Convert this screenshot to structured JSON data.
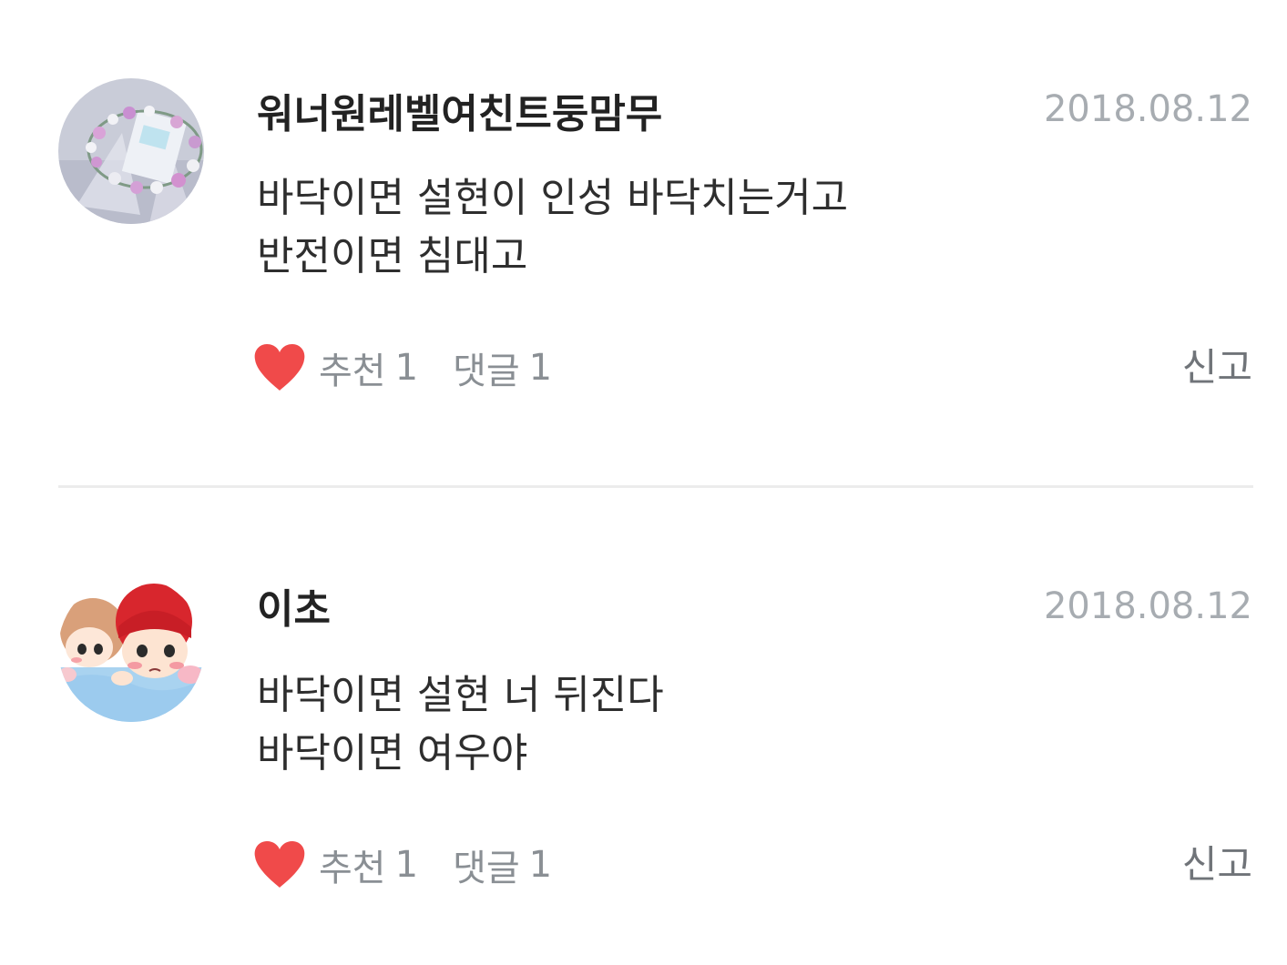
{
  "comments": [
    {
      "username": "워너원레벨여친트둥맘무",
      "date": "2018.08.12",
      "body_lines": [
        "바닥이면 설현이 인성 바닥치는거고",
        "반전이면 침대고"
      ],
      "like_label": "추천",
      "like_count": "1",
      "comment_label": "댓글",
      "comment_count": "1",
      "report_label": "신고",
      "avatar_icon": "flower-crown-photo-avatar"
    },
    {
      "username": "이초",
      "date": "2018.08.12",
      "body_lines": [
        "바닥이면 설현 너 뒤진다",
        "바닥이면 여우야"
      ],
      "like_label": "추천",
      "like_count": "1",
      "comment_label": "댓글",
      "comment_count": "1",
      "report_label": "신고",
      "avatar_icon": "cartoon-characters-avatar"
    }
  ],
  "colors": {
    "heart": "#f04a4a",
    "date": "#a7acb1",
    "meta": "#8a8f94",
    "divider": "#ececec"
  }
}
